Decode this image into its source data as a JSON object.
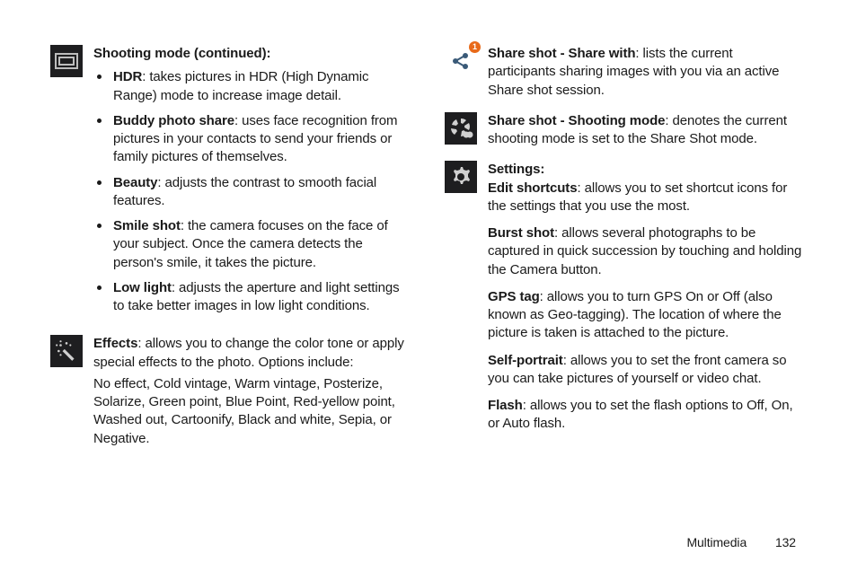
{
  "left": {
    "shooting": {
      "heading": "Shooting mode (continued):",
      "items": [
        {
          "label": "HDR",
          "text": ": takes pictures in HDR (High Dynamic Range) mode to increase image detail."
        },
        {
          "label": "Buddy photo share",
          "text": ": uses face recognition from pictures in your contacts to send your friends or family pictures of themselves."
        },
        {
          "label": "Beauty",
          "text": ": adjusts the contrast to smooth facial features."
        },
        {
          "label": "Smile shot",
          "text": ": the camera focuses on the face of your subject. Once the camera detects the person's smile, it takes the picture."
        },
        {
          "label": "Low light",
          "text": ": adjusts the aperture and light settings to take better images in low light conditions."
        }
      ]
    },
    "effects": {
      "label": "Effects",
      "text": ": allows you to change the color tone or apply special effects to the photo. Options include:",
      "options": "No effect, Cold vintage, Warm vintage, Posterize, Solarize, Green point, Blue Point, Red-yellow point, Washed out, Cartoonify, Black and white, Sepia, or Negative."
    }
  },
  "right": {
    "share_with": {
      "label": "Share shot - Share with",
      "text": ": lists the current participants sharing images with you via an active Share shot session.",
      "badge": "1"
    },
    "share_mode": {
      "label": "Share shot - Shooting mode",
      "text": ": denotes the current shooting mode is set to the Share Shot mode."
    },
    "settings": {
      "heading": "Settings:",
      "items": [
        {
          "label": "Edit shortcuts",
          "text": ": allows you to set shortcut icons for the settings that you use the most."
        },
        {
          "label": "Burst shot",
          "text": ": allows several photographs to be captured in quick succession by touching and holding the Camera button."
        },
        {
          "label": "GPS tag",
          "text": ": allows you to turn GPS On or Off (also known as Geo-tagging). The location of where the picture is taken is attached to the picture."
        },
        {
          "label": "Self-portrait",
          "text": ": allows you to set the front camera so you can take pictures of yourself or video chat."
        },
        {
          "label": "Flash",
          "text": ": allows you to set the flash options to Off, On, or Auto flash."
        }
      ]
    }
  },
  "footer": {
    "chapter": "Multimedia",
    "page": "132"
  }
}
